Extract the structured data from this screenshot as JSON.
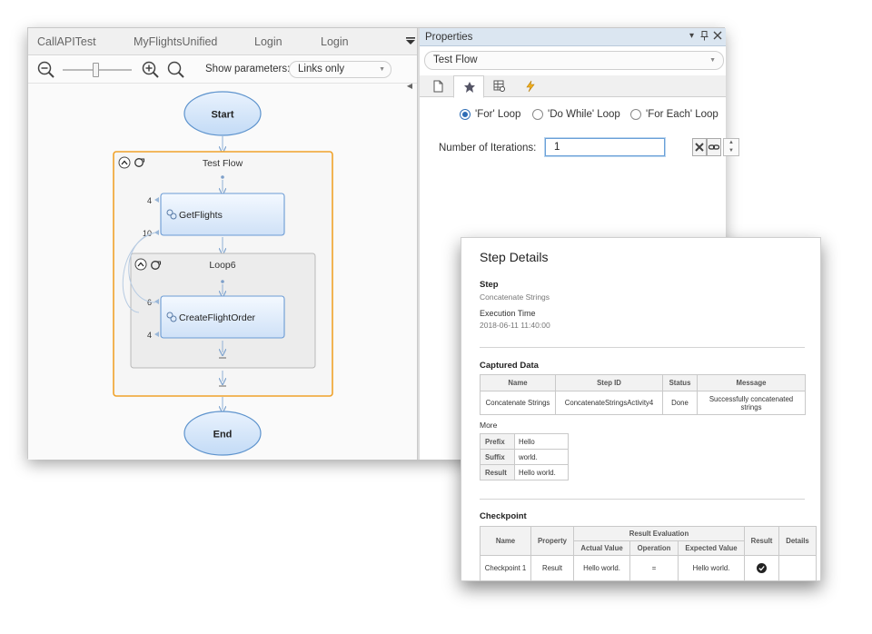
{
  "tabs": [
    {
      "label": "CallAPITest"
    },
    {
      "label": "MyFlightsUnified"
    },
    {
      "label": "Login"
    },
    {
      "label": "Login"
    }
  ],
  "toolbar": {
    "show_parameters_label": "Show parameters:",
    "show_parameters_value": "Links only"
  },
  "flow": {
    "start_label": "Start",
    "end_label": "End",
    "test_flow": {
      "label": "Test Flow",
      "getflights": {
        "label": "GetFlights",
        "in_count": "4",
        "out_count": "10"
      },
      "loop": {
        "label": "Loop6",
        "create_order": {
          "label": "CreateFlightOrder",
          "in_count": "6",
          "out_count": "4"
        }
      }
    }
  },
  "properties": {
    "title": "Properties",
    "scope": "Test Flow",
    "radio_options": [
      {
        "label": "'For' Loop",
        "selected": true
      },
      {
        "label": "'Do While' Loop",
        "selected": false
      },
      {
        "label": "'For Each' Loop",
        "selected": false
      }
    ],
    "iterations_label": "Number of Iterations:",
    "iterations_value": "1"
  },
  "step_details": {
    "title": "Step Details",
    "step_heading": "Step",
    "step_name": "Concatenate Strings",
    "exec_time_label": "Execution Time",
    "exec_time_value": "2018-06-11 11:40:00",
    "captured_heading": "Captured Data",
    "captured_headers": [
      "Name",
      "Step ID",
      "Status",
      "Message"
    ],
    "captured_rows": [
      [
        "Concatenate Strings",
        "ConcatenateStringsActivity4",
        "Done",
        "Successfully concatenated strings"
      ]
    ],
    "more_label": "More",
    "more_rows": [
      {
        "key": "Prefix",
        "value": "Hello"
      },
      {
        "key": "Suffix",
        "value": "world."
      },
      {
        "key": "Result",
        "value": "Hello world."
      }
    ],
    "checkpoint_heading": "Checkpoint",
    "checkpoint_headers": {
      "name": "Name",
      "property": "Property",
      "result_eval": "Result Evaluation",
      "actual": "Actual Value",
      "operation": "Operation",
      "expected": "Expected Value",
      "result": "Result",
      "details": "Details"
    },
    "checkpoint_row": {
      "name": "Checkpoint 1",
      "property": "Result",
      "actual": "Hello world.",
      "operation": "=",
      "expected": "Hello world."
    }
  }
}
